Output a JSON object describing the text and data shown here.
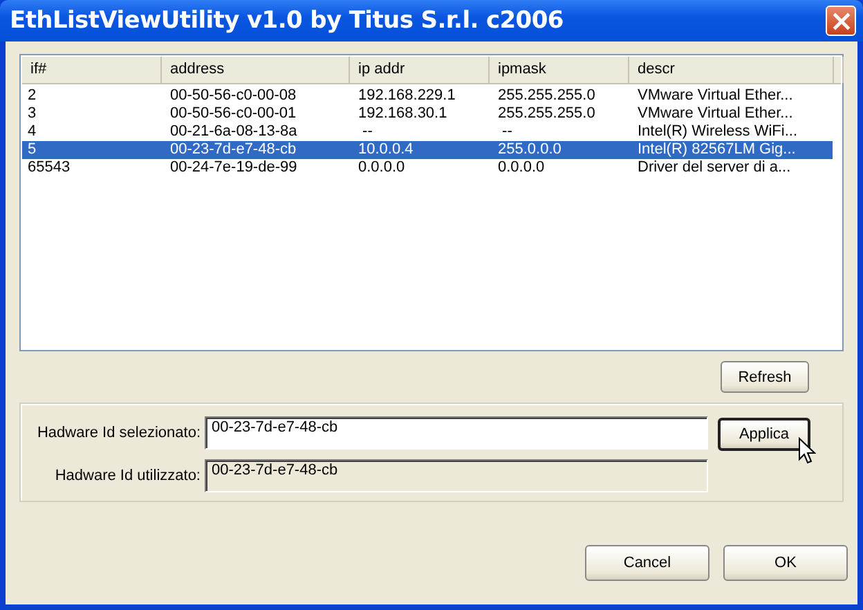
{
  "window": {
    "title": "EthListViewUtility v1.0 by Titus S.r.l. c2006"
  },
  "table": {
    "columns": [
      "if#",
      "address",
      "ip addr",
      "ipmask",
      "descr"
    ],
    "rows": [
      {
        "cells": [
          "2",
          "00-50-56-c0-00-08",
          "192.168.229.1",
          "255.255.255.0",
          "VMware Virtual Ether..."
        ],
        "selected": false
      },
      {
        "cells": [
          "3",
          "00-50-56-c0-00-01",
          "192.168.30.1",
          "255.255.255.0",
          "VMware Virtual Ether..."
        ],
        "selected": false
      },
      {
        "cells": [
          "4",
          "00-21-6a-08-13-8a",
          " --",
          " --",
          "Intel(R) Wireless WiFi..."
        ],
        "selected": false
      },
      {
        "cells": [
          "5",
          "00-23-7d-e7-48-cb",
          "10.0.0.4",
          "255.0.0.0",
          "Intel(R) 82567LM Gig..."
        ],
        "selected": true
      },
      {
        "cells": [
          "65543",
          "00-24-7e-19-de-99",
          "0.0.0.0",
          "0.0.0.0",
          "Driver del server di a..."
        ],
        "selected": false
      }
    ]
  },
  "refresh_button": "Refresh",
  "group": {
    "fields": [
      {
        "label": "Hadware Id selezionato:",
        "value": "00-23-7d-e7-48-cb",
        "disabled": false
      },
      {
        "label": "Hadware Id utilizzato:",
        "value": "00-23-7d-e7-48-cb",
        "disabled": true
      }
    ],
    "apply_button": "Applica"
  },
  "buttons": [
    "Cancel",
    "OK"
  ]
}
